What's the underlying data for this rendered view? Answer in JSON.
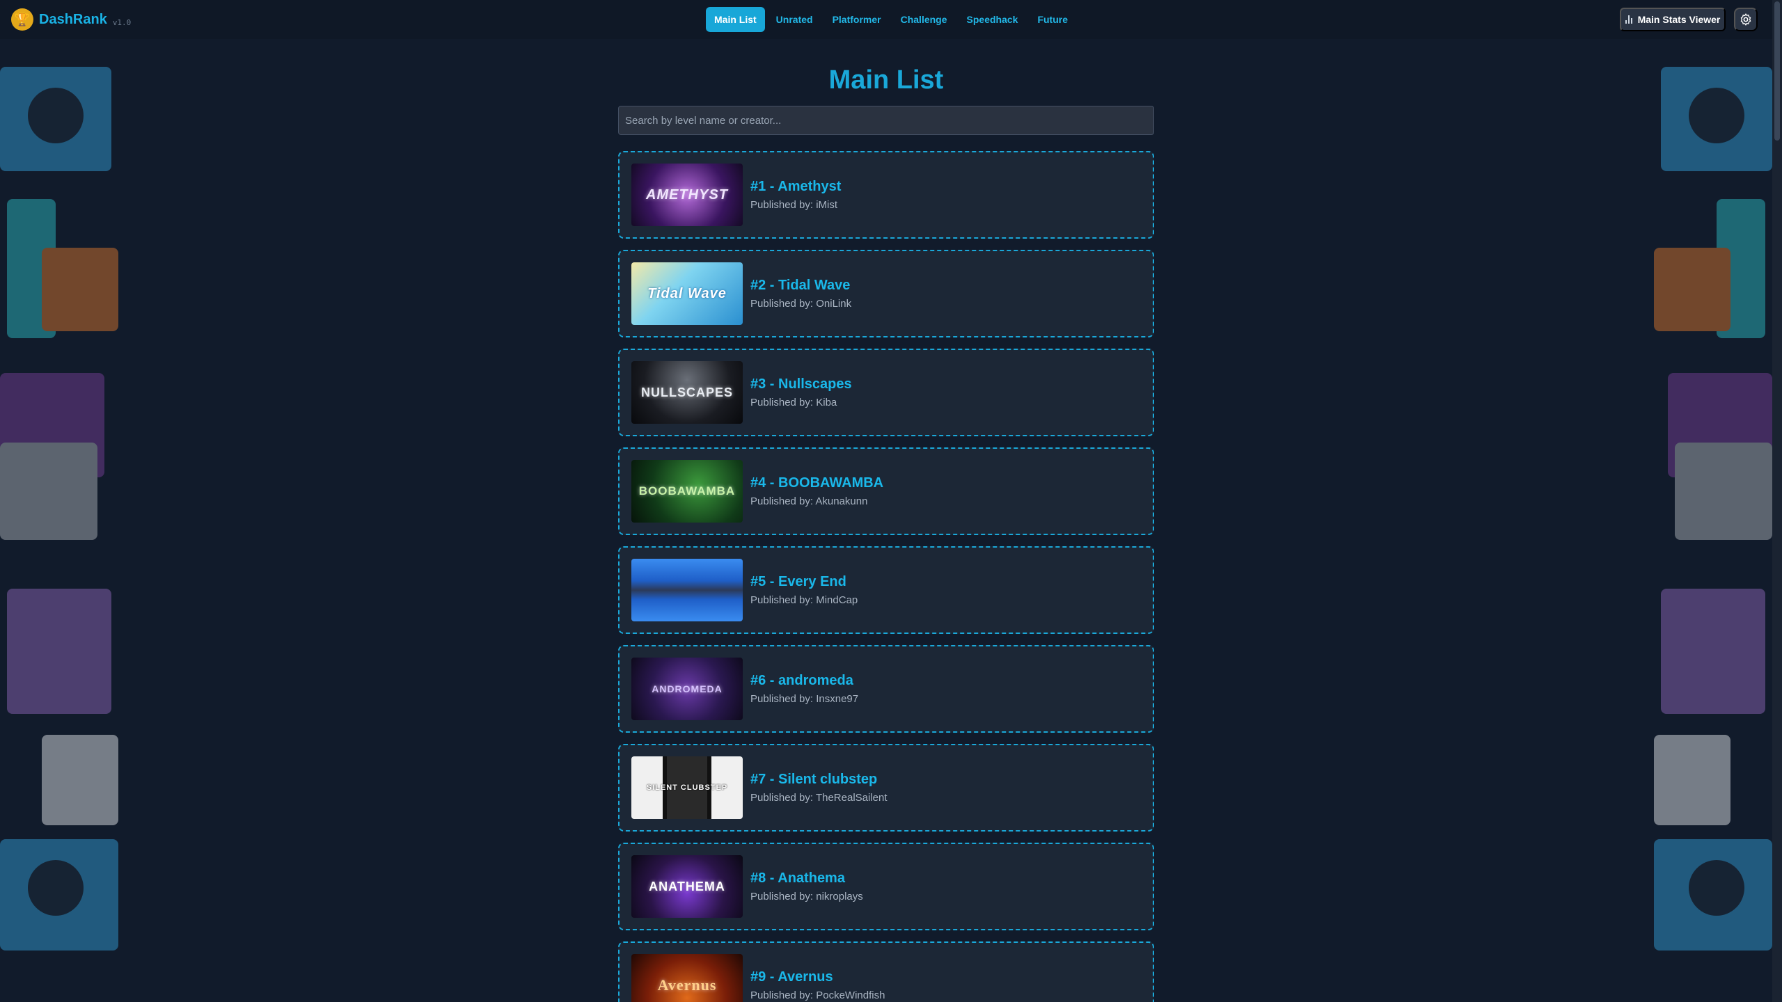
{
  "app": {
    "name": "DashRank",
    "version": "v1.0"
  },
  "nav": {
    "items": [
      {
        "label": "Main List",
        "active": true
      },
      {
        "label": "Unrated",
        "active": false
      },
      {
        "label": "Platformer",
        "active": false
      },
      {
        "label": "Challenge",
        "active": false
      },
      {
        "label": "Speedhack",
        "active": false
      },
      {
        "label": "Future",
        "active": false
      }
    ]
  },
  "header": {
    "stats_button": "Main Stats Viewer"
  },
  "main": {
    "title": "Main List",
    "search_placeholder": "Search by level name or creator...",
    "levels": [
      {
        "title": "#1 - Amethyst",
        "publisher": "Published by: iMist",
        "thumb_text": "AMETHYST"
      },
      {
        "title": "#2 - Tidal Wave",
        "publisher": "Published by: OniLink",
        "thumb_text": "Tidal Wave"
      },
      {
        "title": "#3 - Nullscapes",
        "publisher": "Published by: Kiba",
        "thumb_text": "NULLSCAPES"
      },
      {
        "title": "#4 - BOOBAWAMBA",
        "publisher": "Published by: Akunakunn",
        "thumb_text": "BOOBAWAMBA"
      },
      {
        "title": "#5 - Every End",
        "publisher": "Published by: MindCap",
        "thumb_text": ""
      },
      {
        "title": "#6 - andromeda",
        "publisher": "Published by: Insxne97",
        "thumb_text": "ANDROMEDA"
      },
      {
        "title": "#7 - Silent clubstep",
        "publisher": "Published by: TheRealSailent",
        "thumb_text": "SILENT CLUBSTEP"
      },
      {
        "title": "#8 - Anathema",
        "publisher": "Published by: nikroplays",
        "thumb_text": "ANATHEMA"
      },
      {
        "title": "#9 - Avernus",
        "publisher": "Published by: PockeWindfish",
        "thumb_text": "Avernus"
      }
    ]
  },
  "colors": {
    "accent": "#1aa8d9",
    "background": "#111b2b",
    "card": "#1c2736"
  }
}
